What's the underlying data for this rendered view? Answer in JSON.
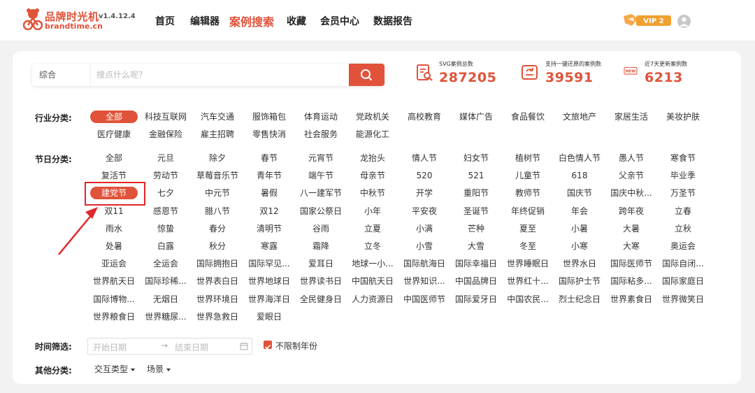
{
  "header": {
    "logo_title": "品牌时光机",
    "logo_version": "v1.4.12.4",
    "logo_domain": "brandtime.cn",
    "nav": [
      "首页",
      "编辑器",
      "案例搜索",
      "收藏",
      "会员中心",
      "数据报告"
    ],
    "active_nav": "案例搜索",
    "vip_label": "VIP 2"
  },
  "search": {
    "type_label": "综合",
    "placeholder": "搜点什么呢?"
  },
  "stats": [
    {
      "icon": "document-search-icon",
      "label": "SVG案例总数",
      "value": "287205"
    },
    {
      "icon": "restore-icon",
      "label": "支持一键还原的案例数",
      "value": "39591"
    },
    {
      "icon": "new-badge-icon",
      "badge": "NEW",
      "label": "近7天更新案例数",
      "value": "6213"
    }
  ],
  "industry": {
    "label": "行业分类:",
    "items": [
      "全部",
      "科技互联网",
      "汽车交通",
      "服饰箱包",
      "体育运动",
      "党政机关",
      "高校教育",
      "媒体广告",
      "食品餐饮",
      "文旅地产",
      "家居生活",
      "美妆护肤",
      "医疗健康",
      "金融保险",
      "雇主招聘",
      "零售快消",
      "社会服务",
      "能源化工"
    ],
    "active": "全部"
  },
  "festival": {
    "label": "节日分类:",
    "items": [
      "全部",
      "元旦",
      "除夕",
      "春节",
      "元宵节",
      "龙抬头",
      "情人节",
      "妇女节",
      "植树节",
      "白色情人节",
      "愚人节",
      "寒食节",
      "复活节",
      "劳动节",
      "草莓音乐节",
      "青年节",
      "端午节",
      "母亲节",
      "520",
      "521",
      "儿童节",
      "618",
      "父亲节",
      "毕业季",
      "建党节",
      "七夕",
      "中元节",
      "暑假",
      "八一建军节",
      "中秋节",
      "开学",
      "重阳节",
      "教师节",
      "国庆节",
      "国庆中秋...",
      "万圣节",
      "双11",
      "感恩节",
      "腊八节",
      "双12",
      "国家公祭日",
      "小年",
      "平安夜",
      "圣诞节",
      "年终促销",
      "年会",
      "跨年夜",
      "立春",
      "雨水",
      "惊蛰",
      "春分",
      "清明节",
      "谷雨",
      "立夏",
      "小满",
      "芒种",
      "夏至",
      "小暑",
      "大暑",
      "立秋",
      "处暑",
      "白露",
      "秋分",
      "寒露",
      "霜降",
      "立冬",
      "小雪",
      "大雪",
      "冬至",
      "小寒",
      "大寒",
      "奥运会",
      "亚运会",
      "全运会",
      "国际拥抱日",
      "国际罕见...",
      "爱耳日",
      "地球一小...",
      "国际航海日",
      "国际幸福日",
      "世界睡眠日",
      "世界水日",
      "国际医师节",
      "国际自闭...",
      "世界航天日",
      "国际珍稀...",
      "世界表白日",
      "世界地球日",
      "世界读书日",
      "中国航天日",
      "世界知识...",
      "中国品牌日",
      "世界红十...",
      "国际护士节",
      "国际粘多...",
      "国际家庭日",
      "国际博物...",
      "无烟日",
      "世界环境日",
      "世界海洋日",
      "全民健身日",
      "人力资源日",
      "中国医师节",
      "国际爱牙日",
      "中国农民...",
      "烈士纪念日",
      "世界素食日",
      "世界微笑日",
      "世界粮食日",
      "世界糖尿...",
      "世界急救日",
      "爱眼日"
    ],
    "active": "建党节"
  },
  "time_filter": {
    "label": "时间筛选:",
    "start_placeholder": "开始日期",
    "arrow": "→",
    "end_placeholder": "结束日期",
    "unlimited_label": "不限制年份",
    "unlimited_checked": true
  },
  "other": {
    "label": "其他分类:",
    "dropdowns": [
      "交互类型",
      "场景"
    ]
  },
  "colors": {
    "accent": "#e0533a",
    "annotation": "#e0272a"
  }
}
